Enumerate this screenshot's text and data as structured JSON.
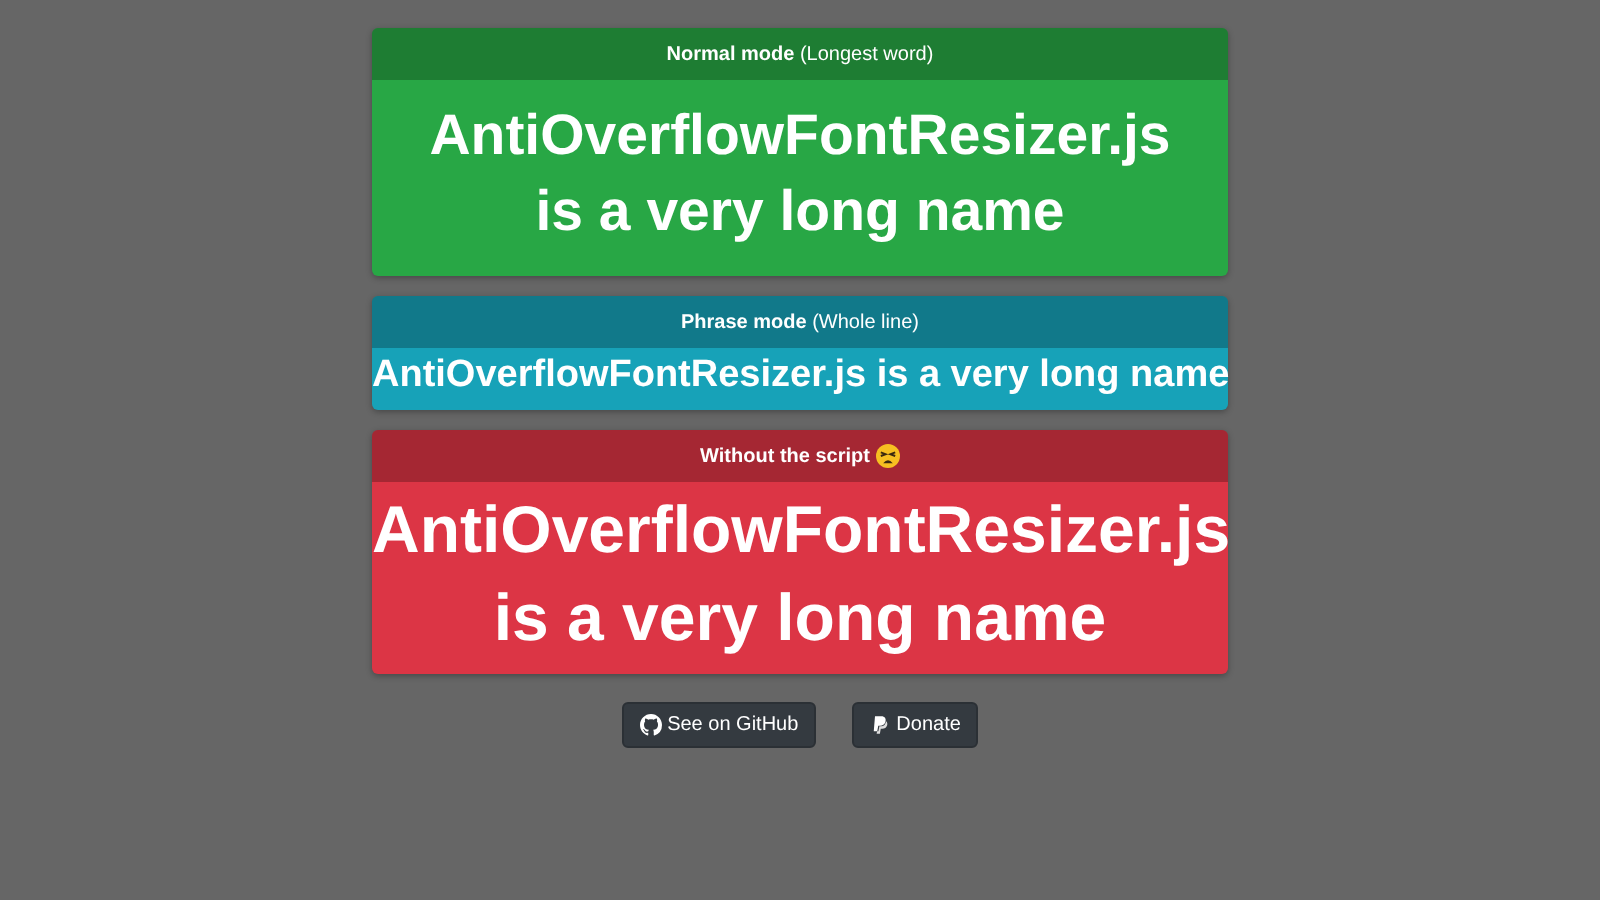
{
  "cards": [
    {
      "kind": "word",
      "color": "#28a745",
      "header": "**Normal mode** (Longest word)",
      "lines": [
        "AntiOverflowFontResizer.js",
        "is a very long name"
      ]
    },
    {
      "kind": "phrase",
      "color": "#17a2b8",
      "header": "**Phrase mode** (Whole line)",
      "lines": [
        "AntiOverflowFontResizer.js is a very long name"
      ]
    },
    {
      "kind": "none",
      "color": "#dc3545",
      "header": "**Without the script**",
      "emoji": true,
      "lines": [
        "AntiOverflowFontResizer.js",
        "is a very long name"
      ]
    }
  ],
  "buttons": [
    {
      "kind": "github",
      "label": "See on GitHub"
    },
    {
      "kind": "paypal",
      "label": "Donate"
    }
  ]
}
